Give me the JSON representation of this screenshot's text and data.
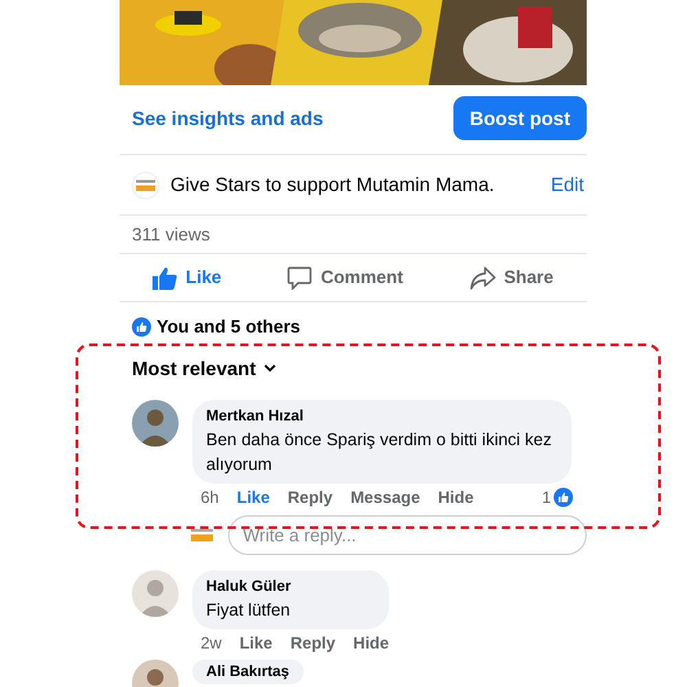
{
  "insights_link": "See insights and ads",
  "boost_button": "Boost post",
  "stars_prompt": {
    "text": "Give Stars to support Mutamin Mama.",
    "action": "Edit"
  },
  "views": "311 views",
  "actions": [
    {
      "kind": "like",
      "label": "Like",
      "selected": true
    },
    {
      "kind": "comment",
      "label": "Comment",
      "selected": false
    },
    {
      "kind": "share",
      "label": "Share",
      "selected": false
    }
  ],
  "reactions": "You and 5 others",
  "sort": "Most relevant",
  "comments": [
    {
      "author": "Mertkan Hızal",
      "text": "Ben daha önce Spariş verdim o bitti ikinci kez alıyorum",
      "time": "6h",
      "links": [
        {
          "label": "Like",
          "selected": true
        },
        {
          "label": "Reply",
          "selected": false
        },
        {
          "label": "Message",
          "selected": false
        },
        {
          "label": "Hide",
          "selected": false
        }
      ],
      "likes": "1",
      "reply_placeholder": "Write a reply...",
      "highlighted": true
    },
    {
      "author": "Haluk Güler",
      "text": "Fiyat lütfen",
      "time": "2w",
      "links": [
        {
          "label": "Like",
          "selected": false
        },
        {
          "label": "Reply",
          "selected": false
        },
        {
          "label": "Hide",
          "selected": false
        }
      ],
      "highlighted": false
    },
    {
      "author": "Ali Bakırtaş",
      "highlighted": false
    }
  ]
}
